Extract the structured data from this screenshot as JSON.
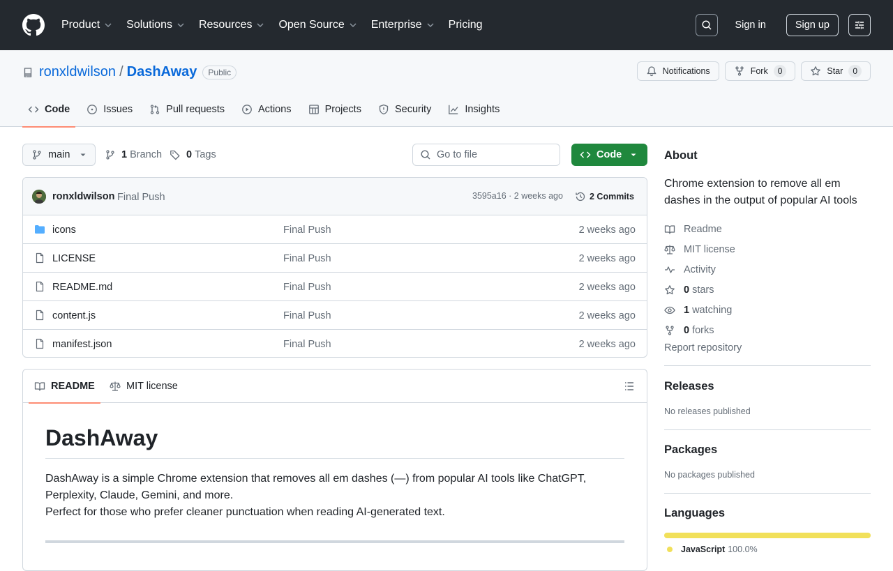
{
  "header": {
    "nav": [
      "Product",
      "Solutions",
      "Resources",
      "Open Source",
      "Enterprise",
      "Pricing"
    ],
    "sign_in": "Sign in",
    "sign_up": "Sign up"
  },
  "repo": {
    "owner": "ronxldwilson",
    "separator": "/",
    "name": "DashAway",
    "visibility": "Public",
    "notifications": "Notifications",
    "fork_label": "Fork",
    "fork_count": "0",
    "star_label": "Star",
    "star_count": "0"
  },
  "tabs": [
    "Code",
    "Issues",
    "Pull requests",
    "Actions",
    "Projects",
    "Security",
    "Insights"
  ],
  "toolbar": {
    "branch": "main",
    "branch_count": "1",
    "branch_label": "Branch",
    "tag_count": "0",
    "tag_label": "Tags",
    "go_to_file": "Go to file",
    "code_button": "Code"
  },
  "commit": {
    "author": "ronxldwilson",
    "message": "Final Push",
    "sha_time": "3595a16 · 2 weeks ago",
    "commits": "2 Commits"
  },
  "files": [
    {
      "name": "icons",
      "type": "folder",
      "message": "Final Push",
      "date": "2 weeks ago"
    },
    {
      "name": "LICENSE",
      "type": "file",
      "message": "Final Push",
      "date": "2 weeks ago"
    },
    {
      "name": "README.md",
      "type": "file",
      "message": "Final Push",
      "date": "2 weeks ago"
    },
    {
      "name": "content.js",
      "type": "file",
      "message": "Final Push",
      "date": "2 weeks ago"
    },
    {
      "name": "manifest.json",
      "type": "file",
      "message": "Final Push",
      "date": "2 weeks ago"
    }
  ],
  "readme": {
    "tab_readme": "README",
    "tab_license": "MIT license",
    "title": "DashAway",
    "line1": "DashAway is a simple Chrome extension that removes all em dashes (—) from popular AI tools like ChatGPT, Perplexity, Claude, Gemini, and more.",
    "line2": "Perfect for those who prefer cleaner punctuation when reading AI-generated text."
  },
  "about": {
    "heading": "About",
    "description": "Chrome extension to remove all em dashes in the output of popular AI tools",
    "readme": "Readme",
    "license": "MIT license",
    "activity": "Activity",
    "stars_count": "0",
    "stars_label": "stars",
    "watching_count": "1",
    "watching_label": "watching",
    "forks_count": "0",
    "forks_label": "forks",
    "report": "Report repository"
  },
  "releases": {
    "heading": "Releases",
    "text": "No releases published"
  },
  "packages": {
    "heading": "Packages",
    "text": "No packages published"
  },
  "languages": {
    "heading": "Languages",
    "name": "JavaScript",
    "percent": "100.0%",
    "fraction": 1.0,
    "color": "#f1e05a"
  }
}
